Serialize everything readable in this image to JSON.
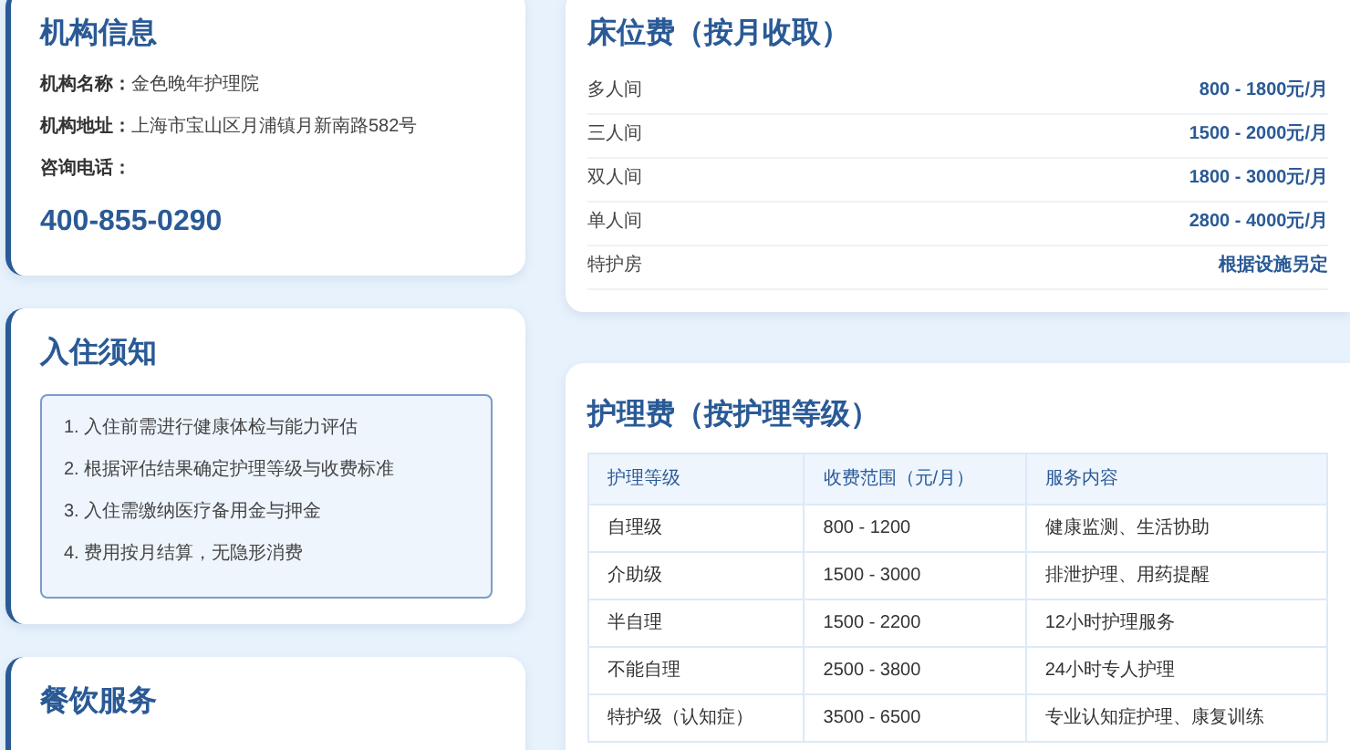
{
  "institution": {
    "title": "机构信息",
    "fields": [
      {
        "label": "机构名称：",
        "value": "金色晚年护理院"
      },
      {
        "label": "机构地址：",
        "value": "上海市宝山区月浦镇月新南路582号"
      },
      {
        "label": "咨询电话："
      }
    ],
    "phone": "400-855-0290"
  },
  "admission": {
    "title": "入住须知",
    "items": [
      "1. 入住前需进行健康体检与能力评估",
      "2. 根据评估结果确定护理等级与收费标准",
      "3. 入住需缴纳医疗备用金与押金",
      "4. 费用按月结算，无隐形消费"
    ]
  },
  "dining": {
    "title": "餐饮服务"
  },
  "bed_fees": {
    "title": "床位费（按月收取）",
    "rows": [
      {
        "room": "多人间",
        "price": "800 - 1800元/月"
      },
      {
        "room": "三人间",
        "price": "1500 - 2000元/月"
      },
      {
        "room": "双人间",
        "price": "1800 - 3000元/月"
      },
      {
        "room": "单人间",
        "price": "2800 - 4000元/月"
      },
      {
        "room": "特护房",
        "price": "根据设施另定"
      }
    ]
  },
  "care_fees": {
    "title": "护理费（按护理等级）",
    "columns": [
      "护理等级",
      "收费范围（元/月）",
      "服务内容"
    ],
    "rows": [
      [
        "自理级",
        "800 - 1200",
        "健康监测、生活协助"
      ],
      [
        "介助级",
        "1500 - 3000",
        "排泄护理、用药提醒"
      ],
      [
        "半自理",
        "1500 - 2200",
        "12小时护理服务"
      ],
      [
        "不能自理",
        "2500 - 3800",
        "24小时专人护理"
      ],
      [
        "特护级（认知症）",
        "3500 - 6500",
        "专业认知症护理、康复训练"
      ]
    ]
  }
}
